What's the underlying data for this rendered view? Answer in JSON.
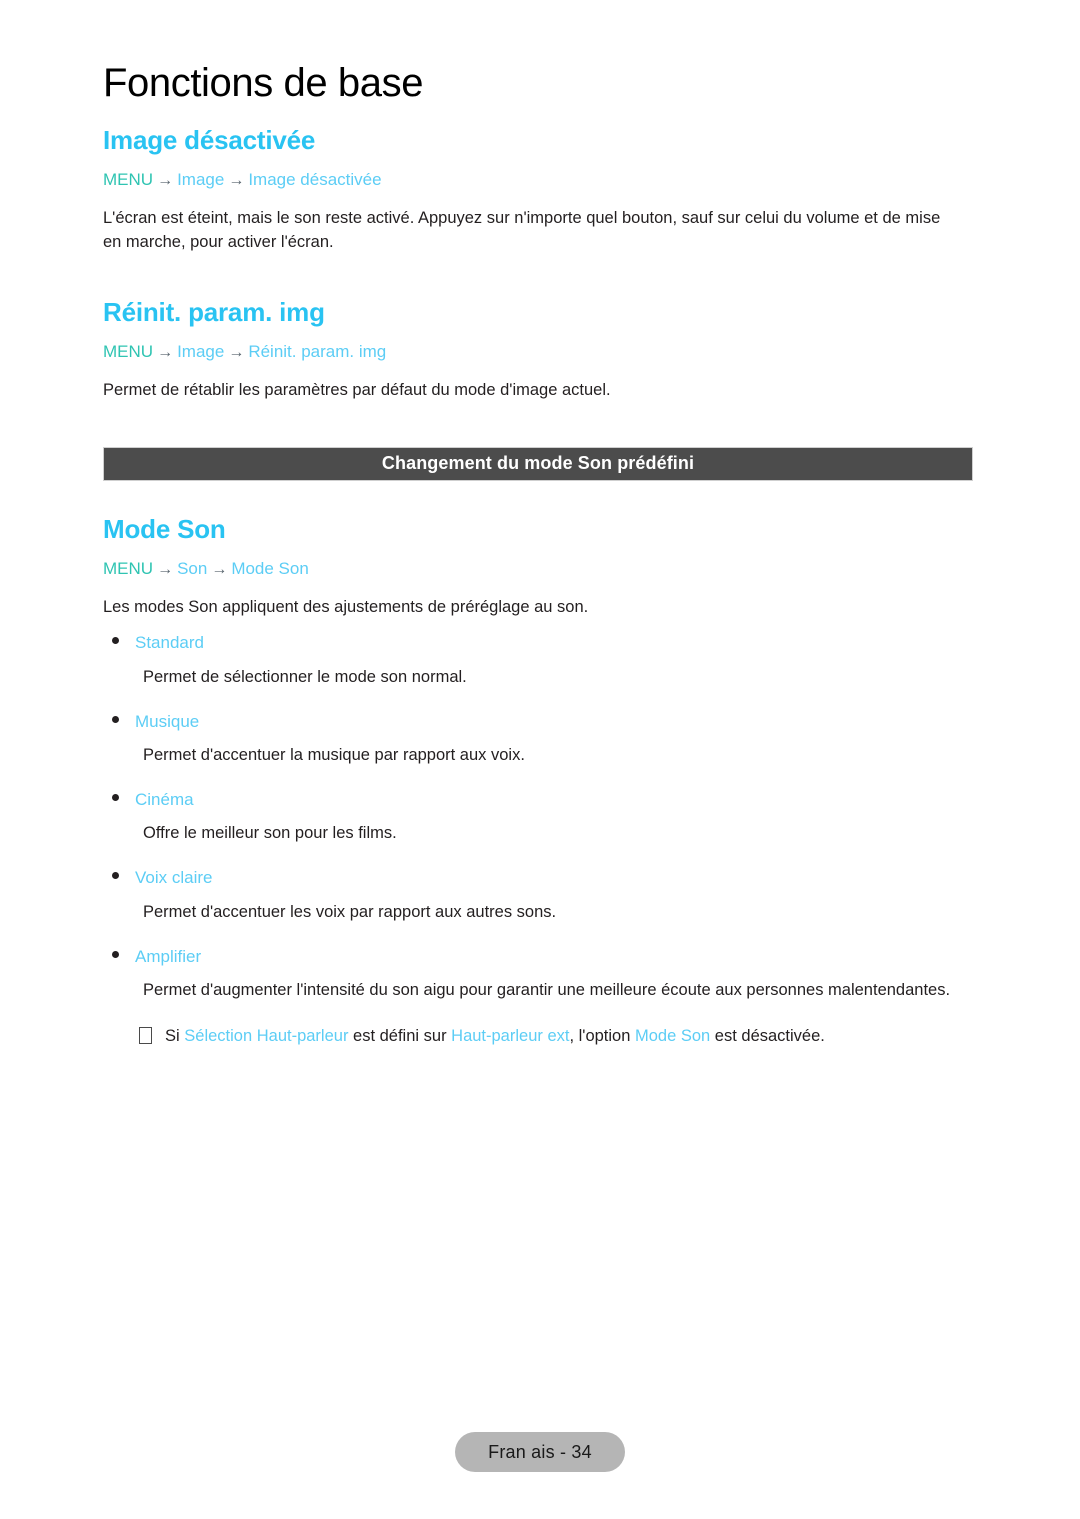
{
  "page": {
    "chapter_title": "Fonctions de base",
    "footer_label": "Fran ais - 34",
    "accent_cyan": "#29c3f2",
    "accent_link": "#5ccdf5",
    "accent_teal": "#2fc4b2",
    "banner_bg": "#4c4c4c",
    "footer_pill_bg": "#b5b5b5"
  },
  "sections": {
    "image_off": {
      "heading": "Image désactivée",
      "breadcrumb": {
        "root": "MENU",
        "arrow": "→",
        "step1": "Image",
        "step2": "Image désactivée"
      },
      "body": "L'écran est éteint, mais le son reste activé. Appuyez sur n'importe quel bouton, sauf sur celui du volume et de mise en marche, pour activer l'écran."
    },
    "picture_reset": {
      "heading": "Réinit. param. img",
      "breadcrumb": {
        "root": "MENU",
        "arrow": "→",
        "step1": "Image",
        "step2": "Réinit. param. img"
      },
      "body": "Permet de rétablir les paramètres par défaut du mode d'image actuel."
    },
    "banner": {
      "text": "Changement du mode Son prédéfini"
    },
    "sound_mode": {
      "heading": "Mode Son",
      "breadcrumb": {
        "root": "MENU",
        "arrow": "→",
        "step1": "Son",
        "step2": "Mode Son"
      },
      "body": "Les modes Son appliquent des ajustements de préréglage au son.",
      "options": [
        {
          "label": "Standard",
          "description": "Permet de sélectionner le mode son normal."
        },
        {
          "label": "Musique",
          "description": "Permet d'accentuer la musique par rapport aux voix."
        },
        {
          "label": "Cinéma",
          "description": "Offre le meilleur son pour les films."
        },
        {
          "label": "Voix claire",
          "description": "Permet d'accentuer les voix par rapport aux autres sons."
        },
        {
          "label": "Amplifier",
          "description": "Permet d'augmenter l'intensité du son aigu pour garantir une meilleure écoute aux personnes malentendantes."
        }
      ],
      "note": {
        "icon": "note-box-icon",
        "part1": "Si ",
        "link1": "Sélection Haut-parleur",
        "part2": " est défini sur ",
        "link2": "Haut-parleur ext",
        "part3": ", l'option ",
        "link3": "Mode Son",
        "part4": " est désactivée."
      }
    }
  }
}
